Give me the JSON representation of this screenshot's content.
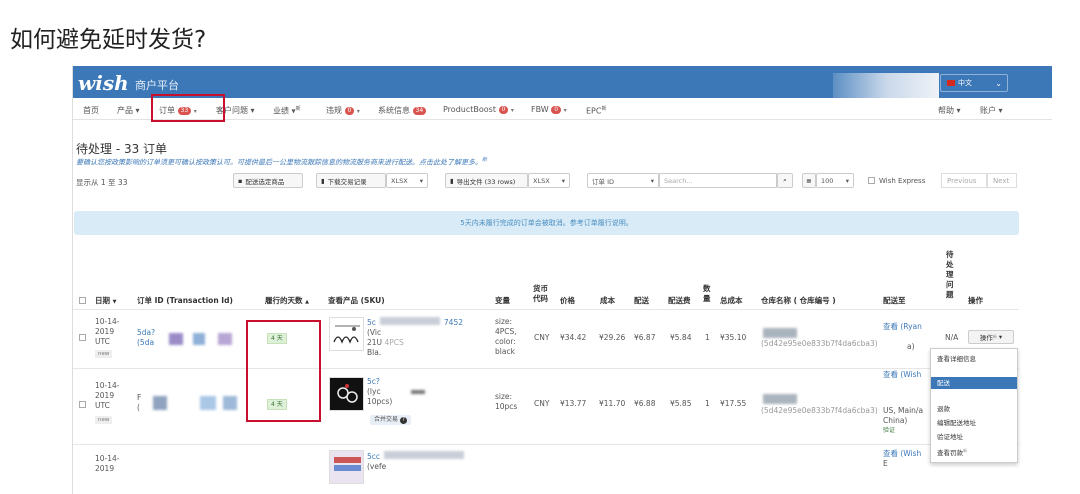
{
  "article": {
    "title": "如何避免延时发货?"
  },
  "header": {
    "logo": "wish",
    "merchant_label": "商户平台",
    "language": "中文"
  },
  "nav": {
    "items": [
      {
        "label": "首页"
      },
      {
        "label": "产品 ▾"
      },
      {
        "label": "订单",
        "badge": "33"
      },
      {
        "label": "客户问题 ▾"
      },
      {
        "label": "业绩 ▾",
        "sup": "新"
      },
      {
        "label": "违规",
        "badge": "0"
      },
      {
        "label": "系统信息",
        "badge": "34"
      },
      {
        "label": "ProductBoost",
        "badge": "0"
      },
      {
        "label": "FBW",
        "badge": "0"
      },
      {
        "label": "EPC",
        "sup": "新"
      }
    ],
    "right": [
      {
        "label": "帮助 ▾"
      },
      {
        "label": "账户 ▾"
      }
    ]
  },
  "page": {
    "title": "待处理 - 33 订单",
    "notice": "要确认您按政策影响的订单须更可确认按政策认可。可提供最后一公里物流跟踪信息的物流服务商来进行配送。点击此处了解更多。",
    "notice_sup": "新",
    "showing": "显示从 1 至 33"
  },
  "toolbar": {
    "ship_selected": "配送选定商品",
    "download_records": "下载交易记录",
    "format1": "XLSX",
    "export_file": "导出文件 (33 rows)",
    "format2": "XLSX",
    "order_id": "订单 ID",
    "search_placeholder": "Search...",
    "per_page": "100",
    "wish_express": "Wish Express",
    "prev": "Previous",
    "next": "Next"
  },
  "info_bar": "5天内未履行完成的订单会被取消。参考订单履行说明。",
  "table": {
    "headers": [
      "日期",
      "订单 ID (Transaction Id)",
      "履行的天数",
      "查看产品 (SKU)",
      "变量",
      "货币代码",
      "价格",
      "成本",
      "配送",
      "配送费",
      "数量",
      "总成本",
      "仓库名称 ( 仓库编号 )",
      "配送至",
      "待处理问题",
      "操作"
    ],
    "rows": [
      {
        "date": [
          "10-14-",
          "2019",
          "UTC"
        ],
        "tag": "new",
        "order_id": [
          "5da?",
          "(5da"
        ],
        "days": "4 天",
        "sku": [
          "5c",
          "7452",
          "(Vic",
          "21U",
          "4PCS",
          "Bla."
        ],
        "variant": [
          "size:",
          "4PCS,",
          "color:",
          "black"
        ],
        "currency": "CNY",
        "price": "¥34.42",
        "cost": "¥29.26",
        "shipping": "¥6.87",
        "ship_fee": "¥5.84",
        "qty": "1",
        "total": "¥35.10",
        "warehouse": "(5d42e95e0e833b7f4da6cba3)",
        "ship_to": [
          "查看 (Ryan",
          "a)"
        ],
        "issue": "N/A",
        "action": "操作"
      },
      {
        "date": [
          "10-14-",
          "2019",
          "UTC"
        ],
        "tag": "new",
        "order_id": [
          "F",
          "("
        ],
        "days": "4 天",
        "sku": [
          "5c?",
          "(lyc",
          "10pcs)"
        ],
        "sku_pill": "合并交易",
        "variant": [
          "size:",
          "10pcs"
        ],
        "currency": "CNY",
        "price": "¥13.77",
        "cost": "¥11.70",
        "shipping": "¥6.88",
        "ship_fee": "¥5.85",
        "qty": "1",
        "total": "¥17.55",
        "warehouse": "(5d42e95e0e833b7f4da6cba3)",
        "ship_to": [
          "查看 (Wish",
          "US, Main/a",
          "China)",
          "验证"
        ],
        "issue": "",
        "action": ""
      },
      {
        "date": [
          "10-14-",
          "2019"
        ],
        "sku": [
          "5cc",
          "(vefe"
        ],
        "ship_to": [
          "查看 (Wish",
          "E"
        ]
      }
    ]
  },
  "dropdown": {
    "items": [
      "查看详细信息",
      "配送",
      "退款",
      "编辑配送地址",
      "验证地址",
      "查看罚款"
    ],
    "active_index": 1,
    "last_sup": "新"
  },
  "colors": {
    "brand": "#3c78b8",
    "highlight": "#c8102e",
    "info_bg": "#d8ebf6"
  }
}
